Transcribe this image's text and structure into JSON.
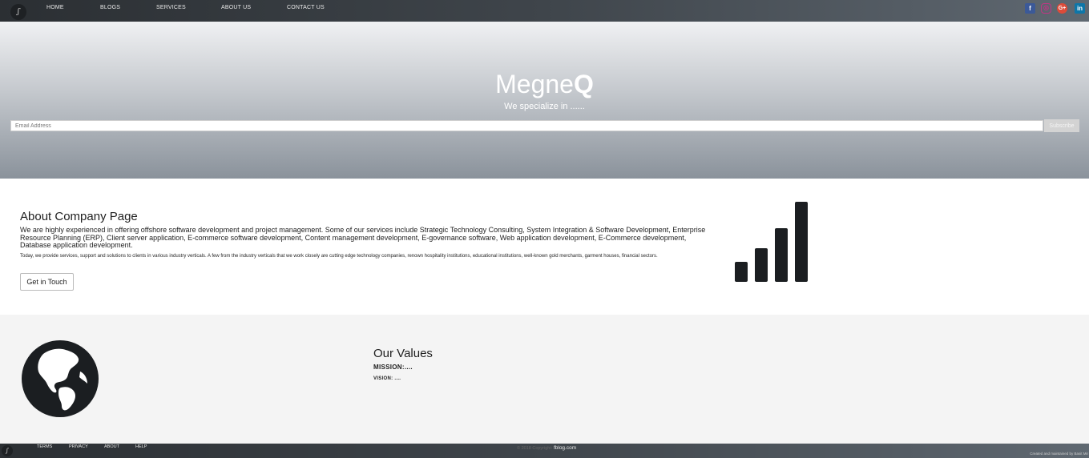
{
  "navbar": {
    "logo_text": "ʃ",
    "links": [
      "HOME",
      "BLOGS",
      "SERVICES",
      "ABOUT US",
      "CONTACT US"
    ],
    "social": [
      {
        "icon": "facebook-icon",
        "glyph": "f",
        "color": "#3b5998"
      },
      {
        "icon": "instagram-icon",
        "glyph": "◎",
        "color": "#c13584"
      },
      {
        "icon": "google-plus-icon",
        "glyph": "G+",
        "color": "#dd4b39"
      },
      {
        "icon": "linkedin-icon",
        "glyph": "in",
        "color": "#0e76a8"
      }
    ]
  },
  "hero": {
    "title_main": "Megne",
    "title_bold": "Q",
    "subtitle": "We specialize in ......",
    "email_placeholder": "Email Address",
    "subscribe_label": "Subscribe"
  },
  "about": {
    "title": "About Company Page",
    "paragraph": "We are highly experienced in offering offshore software development and project management. Some of our services include Strategic Technology Consulting, System Integration & Software Development, Enterprise Resource Planning (ERP), Client server application, E-commerce software development, Content management development, E-governance software, Web application development, E-Commerce development, Database application development.",
    "small_paragraph": "Today, we provide services, support and solutions to clients in various industry verticals. A few from the industry verticals that we work closely are cutting edge technology companies, renown hospitality institutions, educational institutions, well-known gold merchants, garment houses, financial sectors.",
    "button_label": "Get in Touch",
    "icon": "signal-bars-icon",
    "icon_color": "#1b1e21"
  },
  "values": {
    "icon": "globe-icon",
    "title": "Our Values",
    "mission": "MISSION:....",
    "vision": "VISION: ...."
  },
  "footer": {
    "logo_text": "ʃ",
    "links": [
      "TERMS",
      "PRIVACY",
      "ABOUT",
      "HELP"
    ],
    "copyright_prefix": "© 2018 Copyright:",
    "copyright_site": "fblog.com",
    "credit": "Created and maintained by Basit Mir"
  }
}
